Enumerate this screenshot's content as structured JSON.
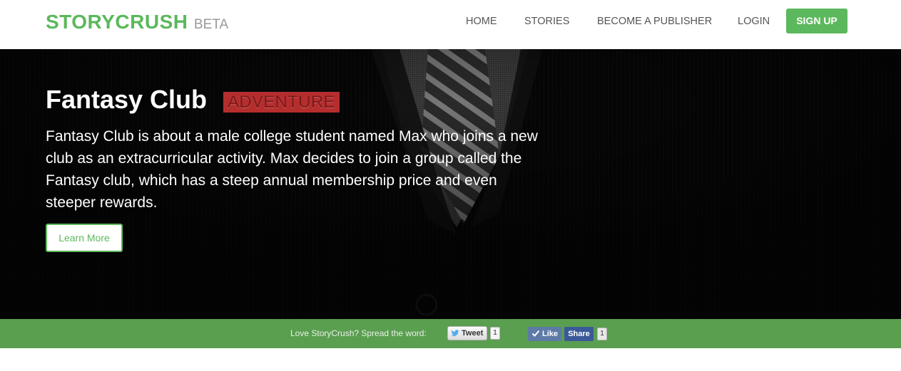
{
  "brand": {
    "name": "STORYCRUSH",
    "tag": "BETA"
  },
  "nav": {
    "home": "HOME",
    "stories": "STORIES",
    "publisher": "BECOME A PUBLISHER",
    "login": "LOGIN",
    "signup": "SIGN UP"
  },
  "hero": {
    "title": "Fantasy Club",
    "genre": "ADVENTURE",
    "description": "Fantasy Club is about a male college student named Max who joins a new club as an extracurricular activity. Max decides to join a group called the Fantasy club, which has a steep annual membership price and even steeper rewards.",
    "cta": "Learn More"
  },
  "share": {
    "text": "Love StoryCrush? Spread the word:",
    "tweet_label": "Tweet",
    "tweet_count": "1",
    "like_label": "Like",
    "share_label": "Share",
    "like_count": "1"
  },
  "colors": {
    "brand_green": "#5cb85c",
    "share_bar": "#5a9e50",
    "genre_badge": "#b52e2e",
    "hero_bg": "#060606",
    "facebook_blue": "#3b5998"
  },
  "icons": [
    "twitter-bird-icon",
    "checkmark-icon"
  ]
}
